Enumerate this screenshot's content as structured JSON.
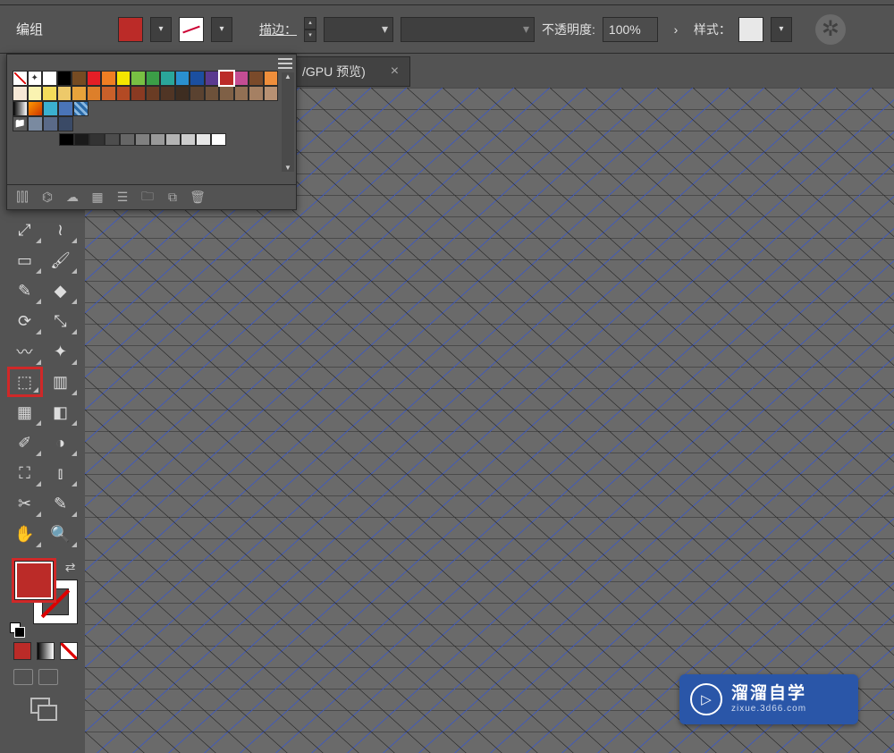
{
  "options_bar": {
    "group_label": "编组",
    "stroke_label": "描边：",
    "opacity_label": "不透明度:",
    "opacity_value": "100%",
    "style_label": "样式："
  },
  "tab": {
    "title": "/GPU 预览)",
    "close": "×"
  },
  "swatches": {
    "rows": [
      [
        "none",
        "reg",
        "#ffffff",
        "#000000",
        "#764b22",
        "#e41e26",
        "#ef7e23",
        "#f4e500",
        "#78c043",
        "#3b9e47",
        "#2aa69a",
        "#2a90cf",
        "#1b4fa0",
        "#5a3a90",
        "#bb2b28",
        "#c44d93",
        "#7a4a2a",
        "#ef8e3b"
      ],
      [
        "#f6e8d6",
        "#faf3b1",
        "#f3dc5b",
        "#edc96a",
        "#e8a33b",
        "#dd7f2a",
        "#c9602a",
        "#b34a24",
        "#8a3a22",
        "#6a3c24",
        "#503525",
        "#3e2d21",
        "#5a4230",
        "#6d513a",
        "#7f6046",
        "#927054",
        "#a58063",
        "#b89173"
      ],
      [
        "gray-grad",
        "orange-grad",
        "#3bb0d0",
        "#4a74b8",
        "pattern"
      ],
      [
        "folder",
        "#7a8aa0",
        "#5a6a88",
        "#3a4a66"
      ]
    ],
    "selected": [
      0,
      14
    ],
    "gray_row": [
      "#000",
      "#1a1a1a",
      "#333",
      "#4d4d4d",
      "#666",
      "#808080",
      "#999",
      "#b3b3b3",
      "#ccc",
      "#e6e6e6",
      "#fff"
    ],
    "footer_icons": [
      "library-icon",
      "link-icon",
      "cloud-icon",
      "grid-options-icon",
      "list-icon",
      "folder-icon",
      "new-swatch-icon",
      "trash-icon"
    ]
  },
  "tools": {
    "rows": [
      [
        "convert-anchor-tool",
        "width-tool"
      ],
      [
        "rectangle-tool",
        "paintbrush-tool"
      ],
      [
        "pencil-tool",
        "eraser-tool"
      ],
      [
        "rotate-tool",
        "scale-tool"
      ],
      [
        "warp-tool",
        "puppet-tool"
      ],
      [
        "shape-builder-tool",
        "perspective-tool"
      ],
      [
        "mesh-tool",
        "gradient-tool"
      ],
      [
        "eyedropper-tool",
        "blend-tool"
      ],
      [
        "symbol-sprayer-tool",
        "graph-tool"
      ],
      [
        "slice-tool",
        "brush-tool-alt"
      ],
      [
        "hand-tool",
        "zoom-tool"
      ]
    ],
    "glyphs": {
      "convert-anchor-tool": "⤢",
      "width-tool": "≀",
      "rectangle-tool": "▭",
      "paintbrush-tool": "🖌",
      "pencil-tool": "✎",
      "eraser-tool": "◆",
      "rotate-tool": "⟳",
      "scale-tool": "⤡",
      "warp-tool": "〰",
      "puppet-tool": "✦",
      "shape-builder-tool": "⬚",
      "perspective-tool": "▥",
      "mesh-tool": "▦",
      "gradient-tool": "◧",
      "eyedropper-tool": "✐",
      "blend-tool": "◑",
      "symbol-sprayer-tool": "⛶",
      "graph-tool": "⫾",
      "slice-tool": "✂",
      "brush-tool-alt": "✎",
      "hand-tool": "✋",
      "zoom-tool": "🔍"
    },
    "highlighted": "shape-builder-tool"
  },
  "watermark": {
    "play": "▷",
    "title": "溜溜自学",
    "url": "zixue.3d66.com"
  }
}
